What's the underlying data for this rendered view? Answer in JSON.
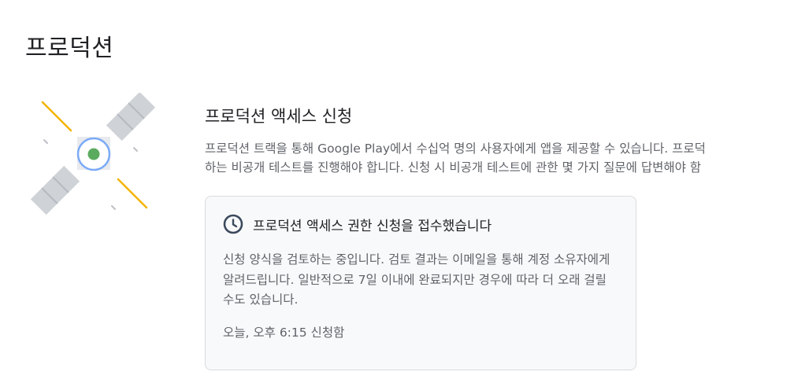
{
  "page": {
    "title": "프로덕션"
  },
  "section": {
    "title": "프로덕션 액세스 신청",
    "description_line1": "프로덕션 트랙을 통해 Google Play에서 수십억 명의 사용자에게 앱을 제공할 수 있습니다. 프로덕",
    "description_line2": "하는 비공개 테스트를 진행해야 합니다. 신청 시 비공개 테스트에 관한 몇 가지 질문에 답변해야 함"
  },
  "status_card": {
    "icon": "clock-icon",
    "title": "프로덕션 액세스 권한 신청을 접수했습니다",
    "body": "신청 양식을 검토하는 중입니다. 검토 결과는 이메일을 통해 계정 소유자에게 알려드립니다. 일반적으로 7일 이내에 완료되지만 경우에 따라 더 오래 걸릴 수도 있습니다.",
    "submitted": "오늘, 오후 6:15 신청함"
  },
  "illustration": {
    "icon": "satellite-icon"
  },
  "colors": {
    "accent_yellow": "#f4b400",
    "accent_blue": "#4285f4",
    "accent_green": "#34a853",
    "panel_gray": "#cfd3d7",
    "clock_navy": "#3c4a5e"
  }
}
